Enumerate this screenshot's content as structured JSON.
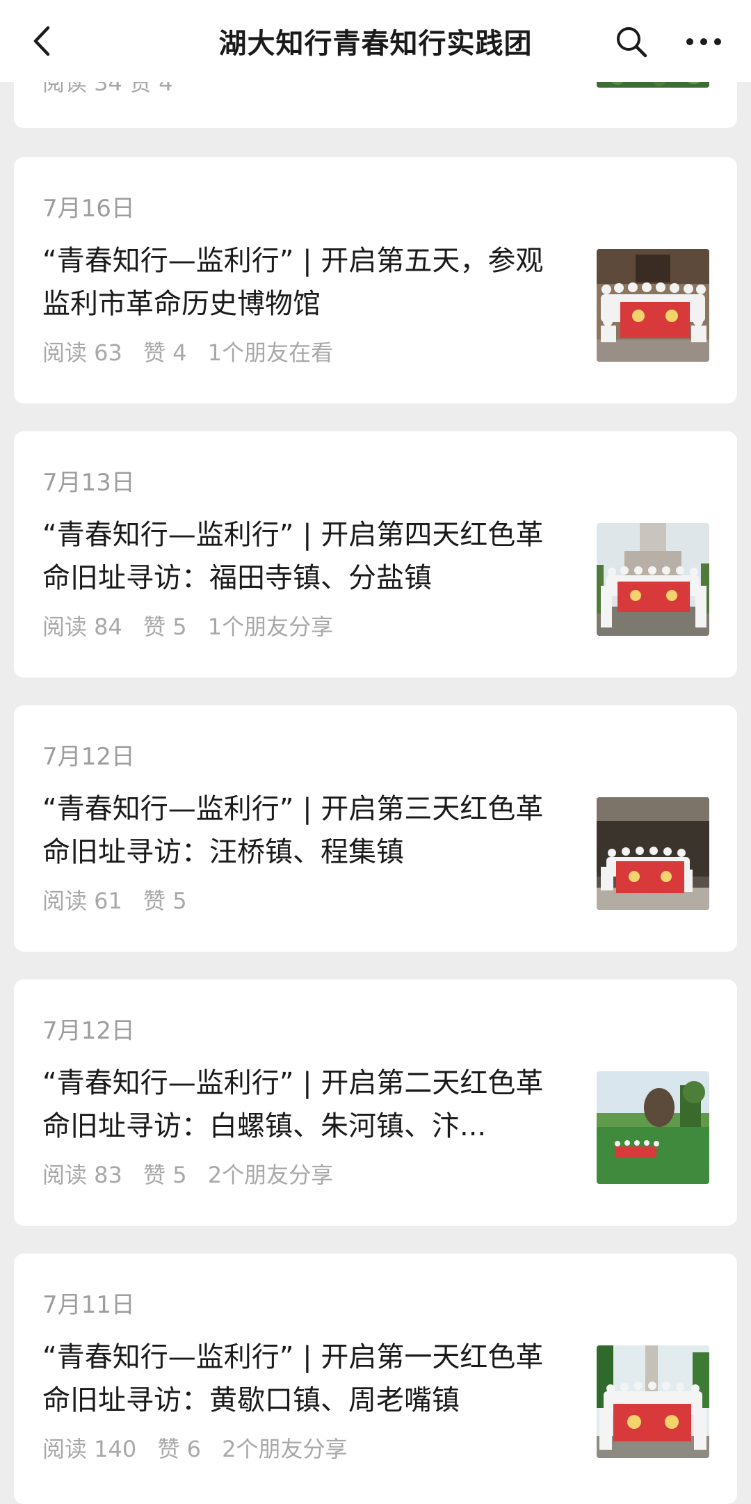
{
  "header": {
    "title": "湖大知行青春知行实践团"
  },
  "partial_card": {
    "meta_text": "阅读 34  赞 4"
  },
  "articles": [
    {
      "date": "7月16日",
      "title": "“青春知行—监利行” | 开启第五天，参观监利市革命历史博物馆",
      "reads": "阅读 63",
      "likes": "赞 4",
      "social": "1个朋友在看"
    },
    {
      "date": "7月13日",
      "title": "“青春知行—监利行” | 开启第四天红色革命旧址寻访：福田寺镇、分盐镇",
      "reads": "阅读 84",
      "likes": "赞 5",
      "social": "1个朋友分享"
    },
    {
      "date": "7月12日",
      "title": "“青春知行—监利行” | 开启第三天红色革命旧址寻访：汪桥镇、程集镇",
      "reads": "阅读 61",
      "likes": "赞 5",
      "social": ""
    },
    {
      "date": "7月12日",
      "title": "“青春知行—监利行” | 开启第二天红色革命旧址寻访：白螺镇、朱河镇、汴...",
      "reads": "阅读 83",
      "likes": "赞 5",
      "social": "2个朋友分享"
    },
    {
      "date": "7月11日",
      "title": "“青春知行—监利行” | 开启第一天红色革命旧址寻访：黄歇口镇、周老嘴镇",
      "reads": "阅读 140",
      "likes": "赞 6",
      "social": "2个朋友分享"
    }
  ],
  "icons": {
    "back": "chevron-left-icon",
    "search": "search-icon",
    "more": "more-dots-icon"
  },
  "colors": {
    "background": "#ededed",
    "card": "#ffffff",
    "meta_text": "#a8a8a8",
    "banner_red": "#d8393a"
  }
}
